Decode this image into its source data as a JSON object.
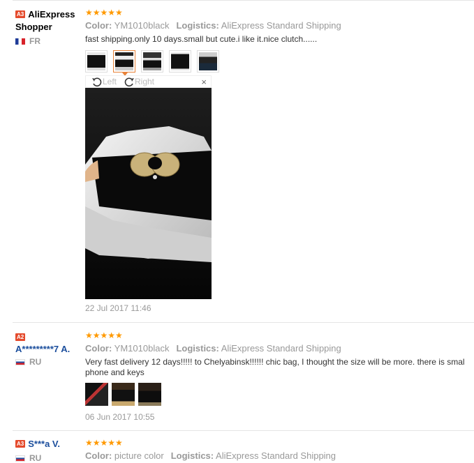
{
  "colors": {
    "star": "#ff9900",
    "level_badge": "#e44a2c",
    "username_blue": "#1a4d9c",
    "selected_thumb": "#e8833a"
  },
  "labels": {
    "color": "Color:",
    "logistics": "Logistics:",
    "rotate_left": "Left",
    "rotate_right": "Right",
    "close": "×"
  },
  "reviews": [
    {
      "level": "A3",
      "user": "AliExpress Shopper",
      "country": "FR",
      "stars": "★★★★★",
      "rating": 5,
      "color": "YM1010black",
      "logistics": "AliExpress Standard Shipping",
      "text": "fast shipping.only 10 days.small but cute.i like it.nice clutch......",
      "date": "22 Jul 2017 11:46"
    },
    {
      "level": "A2",
      "user": "A*********7 A.",
      "country": "RU",
      "stars": "★★★★★",
      "rating": 5,
      "color": "YM1010black",
      "logistics": "AliExpress Standard Shipping",
      "text": "Very fast delivery 12 days!!!!! to Chelyabinsk!!!!!! chic bag, I thought the size will be more. there is smal",
      "text2": "phone and keys",
      "date": "06 Jun 2017 10:55"
    },
    {
      "level": "A3",
      "user": "S***a V.",
      "country": "RU",
      "stars": "★★★★★",
      "rating": 5,
      "color": "picture color",
      "logistics": "AliExpress Standard Shipping"
    }
  ]
}
